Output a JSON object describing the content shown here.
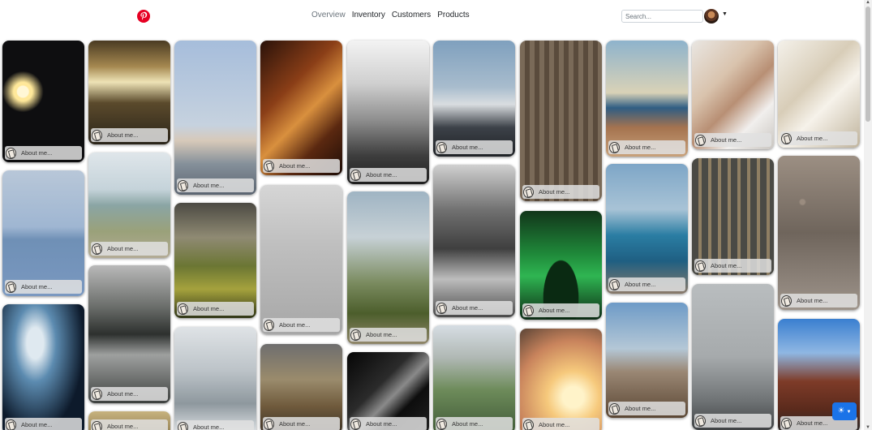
{
  "header": {
    "nav": [
      {
        "label": "Overview",
        "active": true
      },
      {
        "label": "Inventory",
        "active": false
      },
      {
        "label": "Customers",
        "active": false
      },
      {
        "label": "Products",
        "active": false
      }
    ],
    "search_placeholder": "Search...",
    "brand_icon": "pinterest-icon",
    "brand_color": "#e60023"
  },
  "cards": [
    {
      "caption": "About me...",
      "image": "night-lamp-snow"
    },
    {
      "caption": "About me...",
      "image": "blue-lake-hills"
    },
    {
      "caption": "About me...",
      "image": "blurred-light"
    },
    {
      "caption": "About me...",
      "image": "escalator-tunnel"
    },
    {
      "caption": "About me...",
      "image": "beach-boardwalk"
    },
    {
      "caption": "About me...",
      "image": "misty-forest-lake"
    },
    {
      "caption": "About me...",
      "image": "desert-field"
    },
    {
      "caption": "About me...",
      "image": "man-at-lake"
    },
    {
      "caption": "About me...",
      "image": "green-mountains"
    },
    {
      "caption": "About me...",
      "image": "snowy-forest"
    },
    {
      "caption": "About me...",
      "image": "arched-corridor"
    },
    {
      "caption": "About me...",
      "image": "flying-bird"
    },
    {
      "caption": "About me...",
      "image": "rocky-canyon"
    },
    {
      "caption": "About me...",
      "image": "foggy-mountains"
    },
    {
      "caption": "About me...",
      "image": "coastal-cliffs"
    },
    {
      "caption": "About me...",
      "image": "black-building"
    },
    {
      "caption": "About me...",
      "image": "plane-wreck"
    },
    {
      "caption": "About me...",
      "image": "mountain-road"
    },
    {
      "caption": "About me...",
      "image": "river-valley"
    },
    {
      "caption": "About me...",
      "image": "people-on-boardwalk"
    },
    {
      "caption": "About me...",
      "image": "aurora"
    },
    {
      "caption": "About me...",
      "image": "sunset-portrait"
    },
    {
      "caption": "About me...",
      "image": "sunset-sea"
    },
    {
      "caption": "About me...",
      "image": "lake-rocks"
    },
    {
      "caption": "About me...",
      "image": "pier"
    },
    {
      "caption": "About me...",
      "image": "writing-hands"
    },
    {
      "caption": "About me...",
      "image": "railway-tracks"
    },
    {
      "caption": "About me...",
      "image": "misty-dock"
    },
    {
      "caption": "About me...",
      "image": "white-stairs"
    },
    {
      "caption": "About me...",
      "image": "asphalt-texture"
    },
    {
      "caption": "About me...",
      "image": "bridge-street"
    }
  ],
  "fab": {
    "icon": "sun-icon",
    "color": "#1a73e8"
  }
}
